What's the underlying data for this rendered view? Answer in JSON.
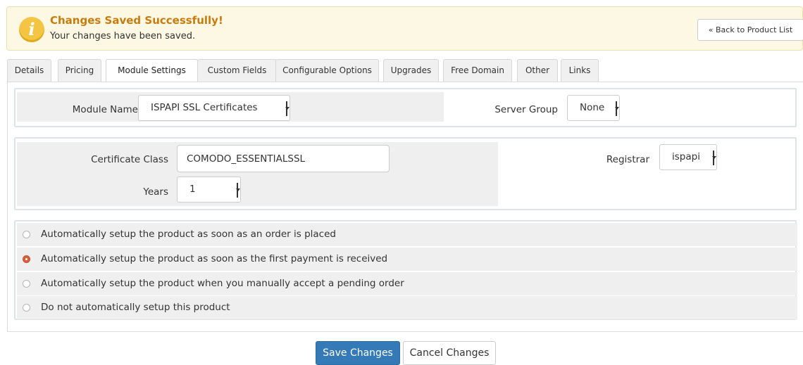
{
  "alert": {
    "title": "Changes Saved Successfully!",
    "message": "Your changes have been saved.",
    "back_label": "« Back to Product List",
    "icon": "info-icon",
    "color": "#fcf8e3"
  },
  "tabs": [
    {
      "label": "Details"
    },
    {
      "label": "Pricing"
    },
    {
      "label": "Module Settings",
      "active": true
    },
    {
      "label": "Custom Fields"
    },
    {
      "label": "Configurable Options"
    },
    {
      "label": "Upgrades"
    },
    {
      "label": "Free Domain"
    },
    {
      "label": "Other"
    },
    {
      "label": "Links"
    }
  ],
  "module": {
    "name_label": "Module Name",
    "name_value": "ISPAPI SSL Certificates",
    "server_group_label": "Server Group",
    "server_group_value": "None"
  },
  "config": {
    "cert_class_label": "Certificate Class",
    "cert_class_value": "COMODO_ESSENTIALSSL",
    "registrar_label": "Registrar",
    "registrar_value": "ispapi",
    "years_label": "Years",
    "years_value": "1"
  },
  "setup_options": [
    {
      "label": "Automatically setup the product as soon as an order is placed",
      "checked": false
    },
    {
      "label": "Automatically setup the product as soon as the first payment is received",
      "checked": true
    },
    {
      "label": "Automatically setup the product when you manually accept a pending order",
      "checked": false
    },
    {
      "label": "Do not automatically setup this product",
      "checked": false
    }
  ],
  "buttons": {
    "save": "Save Changes",
    "cancel": "Cancel Changes"
  },
  "colors": {
    "primary": "#337ab7",
    "radio_checked": "#d9613a"
  }
}
